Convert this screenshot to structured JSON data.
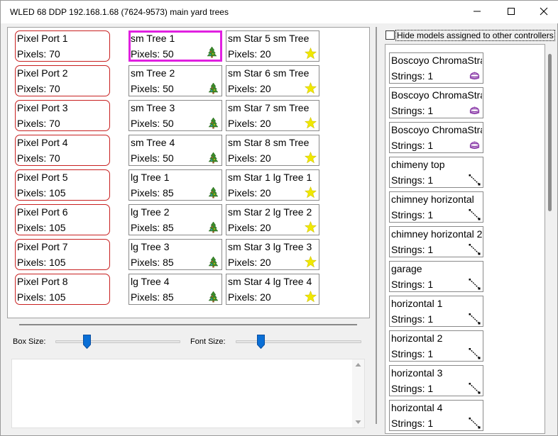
{
  "window": {
    "title": "WLED 68 DDP 192.168.1.68 (7624-9573) main yard trees",
    "controls": {
      "minimize": "—",
      "maximize": "☐",
      "close": "✕"
    }
  },
  "ports": [
    {
      "name": "Pixel Port 1",
      "pixels": "Pixels: 70"
    },
    {
      "name": "Pixel Port 2",
      "pixels": "Pixels: 70"
    },
    {
      "name": "Pixel Port 3",
      "pixels": "Pixels: 70"
    },
    {
      "name": "Pixel Port 4",
      "pixels": "Pixels: 70"
    },
    {
      "name": "Pixel Port 5",
      "pixels": "Pixels: 105"
    },
    {
      "name": "Pixel Port 6",
      "pixels": "Pixels: 105"
    },
    {
      "name": "Pixel Port 7",
      "pixels": "Pixels: 105"
    },
    {
      "name": "Pixel Port 8",
      "pixels": "Pixels: 105"
    }
  ],
  "trees": [
    {
      "name": "sm Tree 1",
      "pixels": "Pixels: 50",
      "icon": "tree-icon",
      "selected": true
    },
    {
      "name": "sm Tree 2",
      "pixels": "Pixels: 50",
      "icon": "tree-icon"
    },
    {
      "name": "sm Tree 3",
      "pixels": "Pixels: 50",
      "icon": "tree-icon"
    },
    {
      "name": "sm Tree 4",
      "pixels": "Pixels: 50",
      "icon": "tree-icon"
    },
    {
      "name": "lg Tree 1",
      "pixels": "Pixels: 85",
      "icon": "tree-icon"
    },
    {
      "name": "lg Tree 2",
      "pixels": "Pixels: 85",
      "icon": "tree-icon"
    },
    {
      "name": "lg Tree 3",
      "pixels": "Pixels: 85",
      "icon": "tree-icon"
    },
    {
      "name": "lg Tree 4",
      "pixels": "Pixels: 85",
      "icon": "tree-icon"
    }
  ],
  "stars": [
    {
      "name": "sm Star 5 sm Tree",
      "pixels": "Pixels: 20",
      "icon": "star-icon"
    },
    {
      "name": "sm Star 6 sm Tree",
      "pixels": "Pixels: 20",
      "icon": "star-icon"
    },
    {
      "name": "sm Star 7 sm Tree",
      "pixels": "Pixels: 20",
      "icon": "star-icon"
    },
    {
      "name": "sm Star 8 sm Tree",
      "pixels": "Pixels: 20",
      "icon": "star-icon"
    },
    {
      "name": "sm Star 1 lg Tree 1",
      "pixels": "Pixels: 20",
      "icon": "star-icon"
    },
    {
      "name": "sm Star 2 lg Tree 2",
      "pixels": "Pixels: 20",
      "icon": "star-icon"
    },
    {
      "name": "sm Star 3 lg Tree 3",
      "pixels": "Pixels: 20",
      "icon": "star-icon"
    },
    {
      "name": "sm Star 4 lg Tree 4",
      "pixels": "Pixels: 20",
      "icon": "star-icon"
    }
  ],
  "controls": {
    "box_size_label": "Box Size:",
    "font_size_label": "Font Size:",
    "box_size_value": 0.25,
    "font_size_value": 0.2
  },
  "hide_models": {
    "label": "Hide models assigned to other controllers",
    "checked": false
  },
  "models": [
    {
      "name": "Boscoyo ChromaStrand",
      "strings": "Strings: 1",
      "icon": "cake-icon"
    },
    {
      "name": "Boscoyo ChromaStrand",
      "strings": "Strings: 1",
      "icon": "cake-icon"
    },
    {
      "name": "Boscoyo ChromaStrand",
      "strings": "Strings: 1",
      "icon": "cake-icon"
    },
    {
      "name": "chimeny top",
      "strings": "Strings: 1",
      "icon": "line-icon"
    },
    {
      "name": "chimney horizontal",
      "strings": "Strings: 1",
      "icon": "line-icon"
    },
    {
      "name": "chimney horizontal 2",
      "strings": "Strings: 1",
      "icon": "line-icon"
    },
    {
      "name": "garage",
      "strings": "Strings: 1",
      "icon": "line-icon"
    },
    {
      "name": "horizontal 1",
      "strings": "Strings: 1",
      "icon": "line-icon"
    },
    {
      "name": "horizontal 2",
      "strings": "Strings: 1",
      "icon": "line-icon"
    },
    {
      "name": "horizontal 3",
      "strings": "Strings: 1",
      "icon": "line-icon"
    },
    {
      "name": "horizontal 4",
      "strings": "Strings: 1",
      "icon": "line-icon"
    }
  ],
  "colors": {
    "port_border": "#c82020",
    "selection": "#e020e0",
    "star": "#f0e800",
    "tree": "#3a8a2a",
    "cake": "#8a3aa8",
    "slider_thumb": "#0a6fd6"
  }
}
